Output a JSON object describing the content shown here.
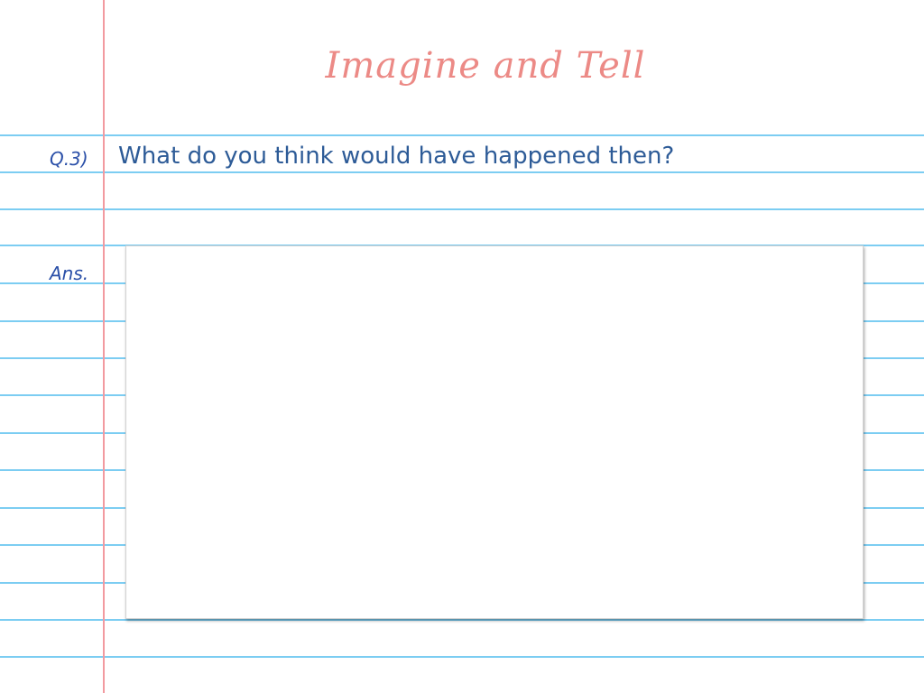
{
  "worksheet": {
    "title": "Imagine and Tell",
    "question_number": "Q.3)",
    "question_text": "What do you think would have happened then?",
    "answer_label": "Ans."
  },
  "colors": {
    "rule_lines": "#7ccdf2",
    "margin_line": "#f29aa0",
    "title": "#ec8a86",
    "question": "#2d5b97",
    "labels": "#2a4fa8"
  }
}
